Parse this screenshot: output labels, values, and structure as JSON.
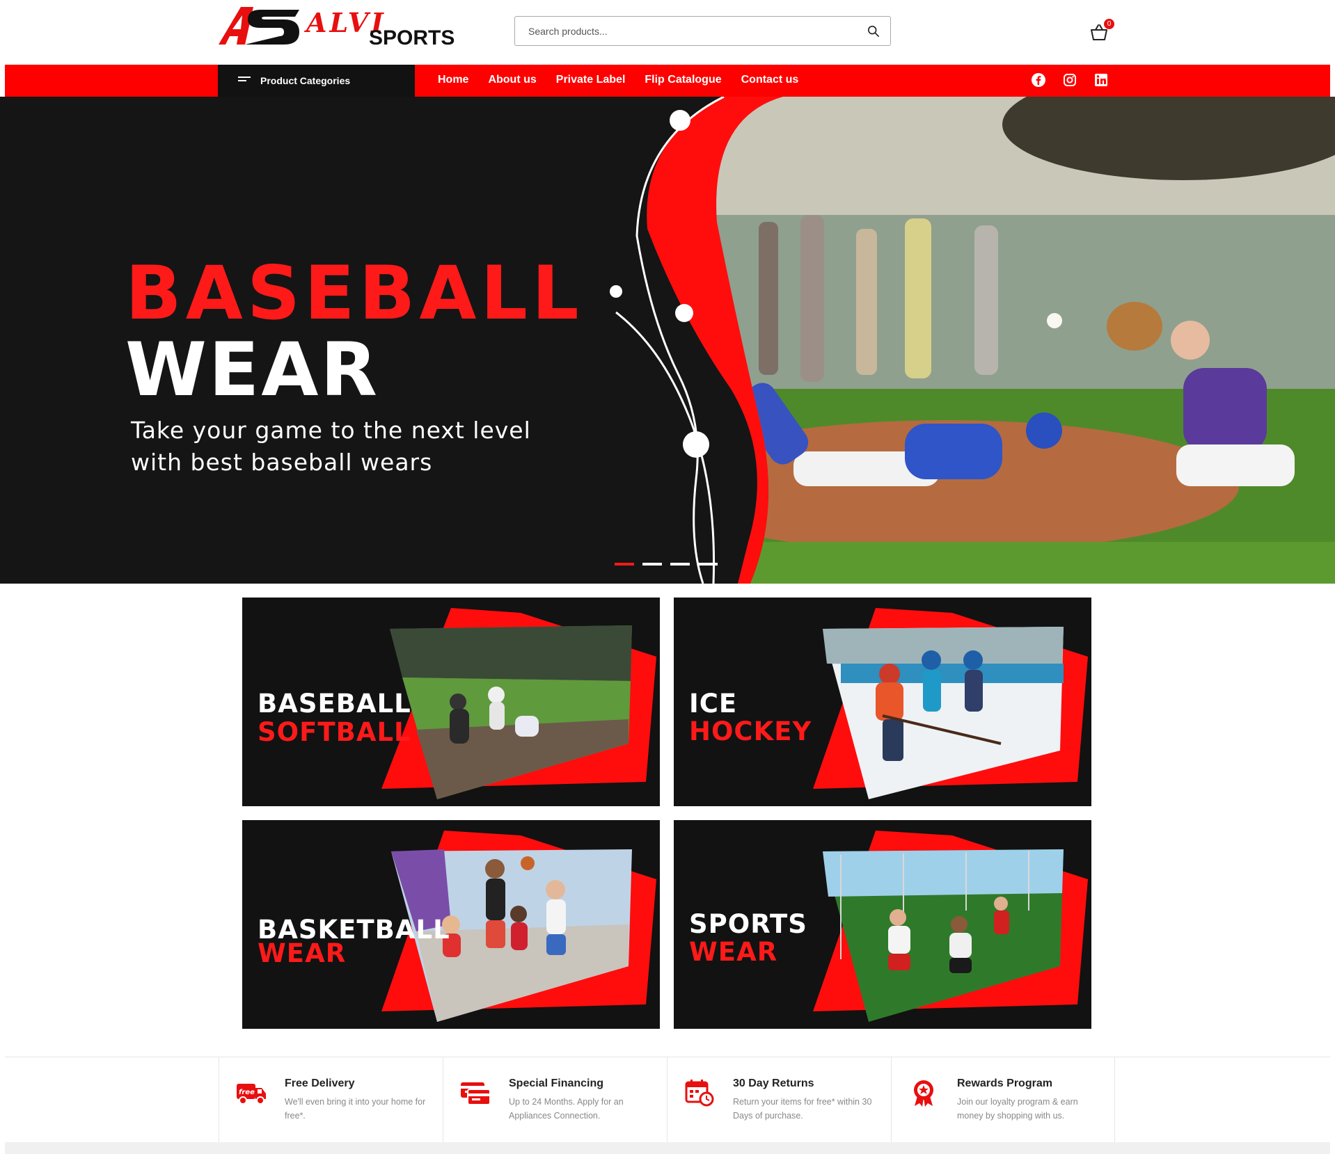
{
  "brand": {
    "logo_mark": "AS",
    "name_top": "ALVI",
    "name_bottom": "SPORTS"
  },
  "search": {
    "placeholder": "Search products..."
  },
  "cart": {
    "count": "0",
    "icon": "basket-icon"
  },
  "nav": {
    "categories_label": "Product Categories",
    "menu": [
      "Home",
      "About us",
      "Private Label",
      "Flip Catalogue",
      "Contact us"
    ],
    "social": [
      "facebook-icon",
      "instagram-icon",
      "linkedin-icon"
    ]
  },
  "hero": {
    "title_line1": "BASEBALL",
    "title_line2": "WEAR",
    "subtitle": "Take your game to the next level with best baseball wears",
    "slides": 4,
    "active_slide": 1
  },
  "tiles": [
    {
      "line1": "BASEBALL",
      "line2": "SOFTBALL"
    },
    {
      "line1": "ICE",
      "line2": "HOCKEY"
    },
    {
      "line1": "BASKETBALL",
      "line2": "WEAR"
    },
    {
      "line1": "SPORTS",
      "line2": "WEAR"
    }
  ],
  "features": [
    {
      "title": "Free Delivery",
      "desc": "We'll even bring it into your home for free*.",
      "icon": "delivery-truck-icon"
    },
    {
      "title": "Special Financing",
      "desc": "Up to 24 Months. Apply for an Appliances Connection.",
      "icon": "credit-card-icon"
    },
    {
      "title": "30 Day Returns",
      "desc": "Return your items for free* within 30 Days of purchase.",
      "icon": "calendar-clock-icon"
    },
    {
      "title": "Rewards Program",
      "desc": "Join our loyalty program & earn money by shopping with us.",
      "icon": "rewards-badge-icon"
    }
  ],
  "colors": {
    "accent": "#ff0000",
    "dark": "#121212"
  }
}
